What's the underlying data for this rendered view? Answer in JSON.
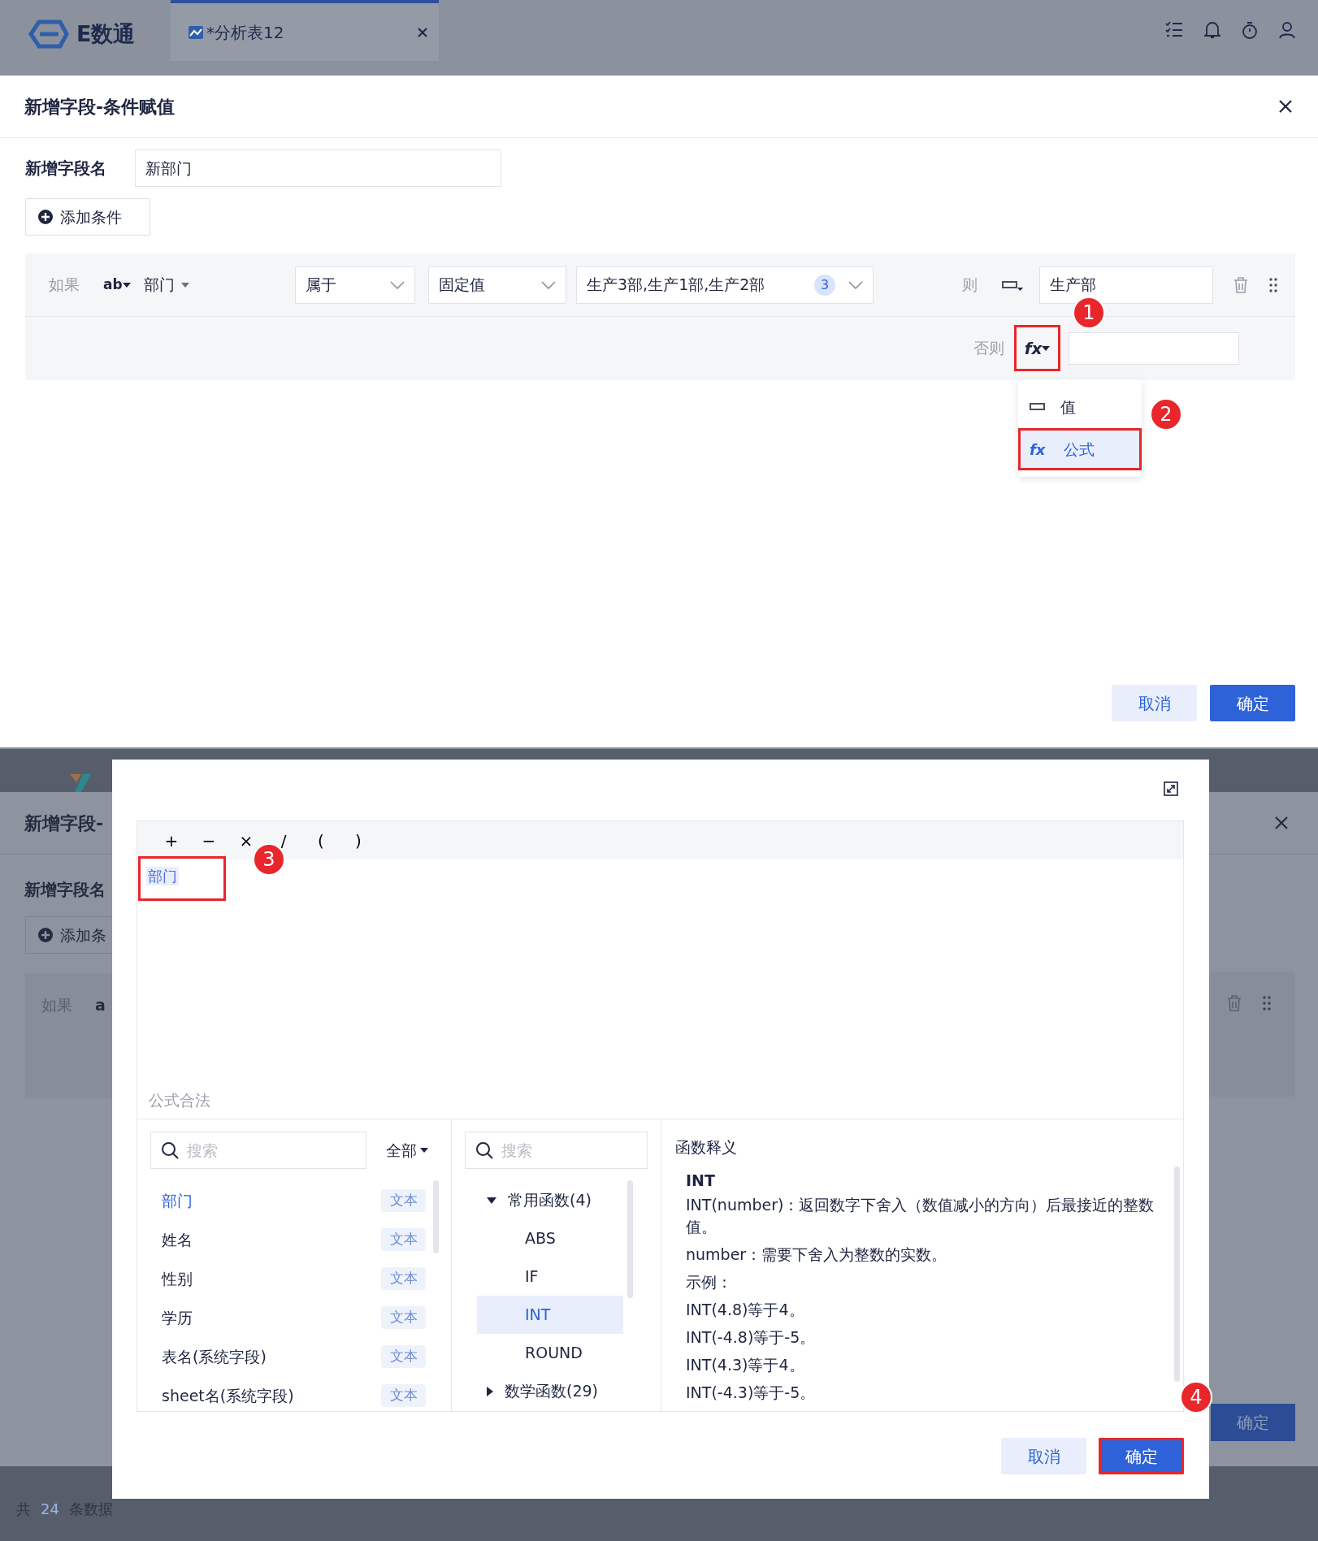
{
  "app_bar": {
    "logo_text": "E数通",
    "tab": {
      "title": "*分析表12"
    }
  },
  "condition_dialog": {
    "title": "新增字段-条件赋值",
    "field_name": {
      "label": "新增字段名",
      "value": "新部门"
    },
    "add_condition_button": "添加条件",
    "condition": {
      "if_label": "如果",
      "field_type": "ab",
      "field": "部门",
      "operator": "属于",
      "value_source": "固定值",
      "values": "生产3部,生产1部,生产2部",
      "values_count": "3",
      "then_label": "则",
      "then_value": "生产部",
      "else_label": "否则",
      "else_type": {
        "glyph": "fx",
        "highlighted": true,
        "step": "1"
      }
    },
    "type_menu": [
      {
        "kind": "value",
        "label": "值",
        "selected": false,
        "highlighted": false
      },
      {
        "kind": "formula",
        "glyph": "fx",
        "label": "公式",
        "selected": true,
        "highlighted": true,
        "step": "2"
      }
    ],
    "buttons": [
      {
        "kind": "cancel",
        "label": "取消",
        "highlighted": false
      },
      {
        "kind": "confirm",
        "label": "确定",
        "highlighted": false
      }
    ]
  },
  "background_dialog": {
    "title": "新增字段-",
    "field_label": "新增字段名",
    "add_condition_button": "添加条",
    "if_label": "如果",
    "field_type": "a",
    "confirm_button": "确定"
  },
  "footer": {
    "prefix": "共",
    "count": "24",
    "suffix": "条数据"
  },
  "formula_dialog": {
    "operators": [
      "+",
      "−",
      "×",
      "/",
      "(",
      ")"
    ],
    "tokens": [
      {
        "label": "部门"
      }
    ],
    "tokens_highlight": {
      "highlighted": true,
      "step": "3"
    },
    "status": "公式合法",
    "fields_search": {
      "placeholder": "搜索"
    },
    "filter": "全部",
    "fields": [
      {
        "name": "部门",
        "type": "文本",
        "selected": true
      },
      {
        "name": "姓名",
        "type": "文本",
        "selected": false
      },
      {
        "name": "性别",
        "type": "文本",
        "selected": false
      },
      {
        "name": "学历",
        "type": "文本",
        "selected": false
      },
      {
        "name": "表名(系统字段)",
        "type": "文本",
        "selected": false
      },
      {
        "name": "sheet名(系统字段)",
        "type": "文本",
        "selected": false
      }
    ],
    "functions_search": {
      "placeholder": "搜索"
    },
    "function_groups": [
      {
        "label": "常用函数(4)",
        "expanded": true,
        "children": [
          {
            "label": "ABS",
            "selected": false
          },
          {
            "label": "IF",
            "selected": false
          },
          {
            "label": "INT",
            "selected": true
          },
          {
            "label": "ROUND",
            "selected": false
          }
        ]
      },
      {
        "label": "数学函数(29)",
        "expanded": false
      }
    ],
    "help": {
      "heading": "函数释义",
      "name": "INT",
      "lines": [
        "INT(number)：返回数字下舍入（数值减小的方向）后最接近的整数值。",
        "number：需要下舍入为整数的实数。",
        "示例：",
        "INT(4.8)等于4。",
        "INT(-4.8)等于-5。",
        "INT(4.3)等于4。",
        "INT(-4.3)等于-5。"
      ]
    },
    "buttons": [
      {
        "kind": "cancel",
        "label": "取消",
        "highlighted": false
      },
      {
        "kind": "confirm",
        "label": "确定",
        "highlighted": true,
        "step": "4"
      }
    ]
  }
}
